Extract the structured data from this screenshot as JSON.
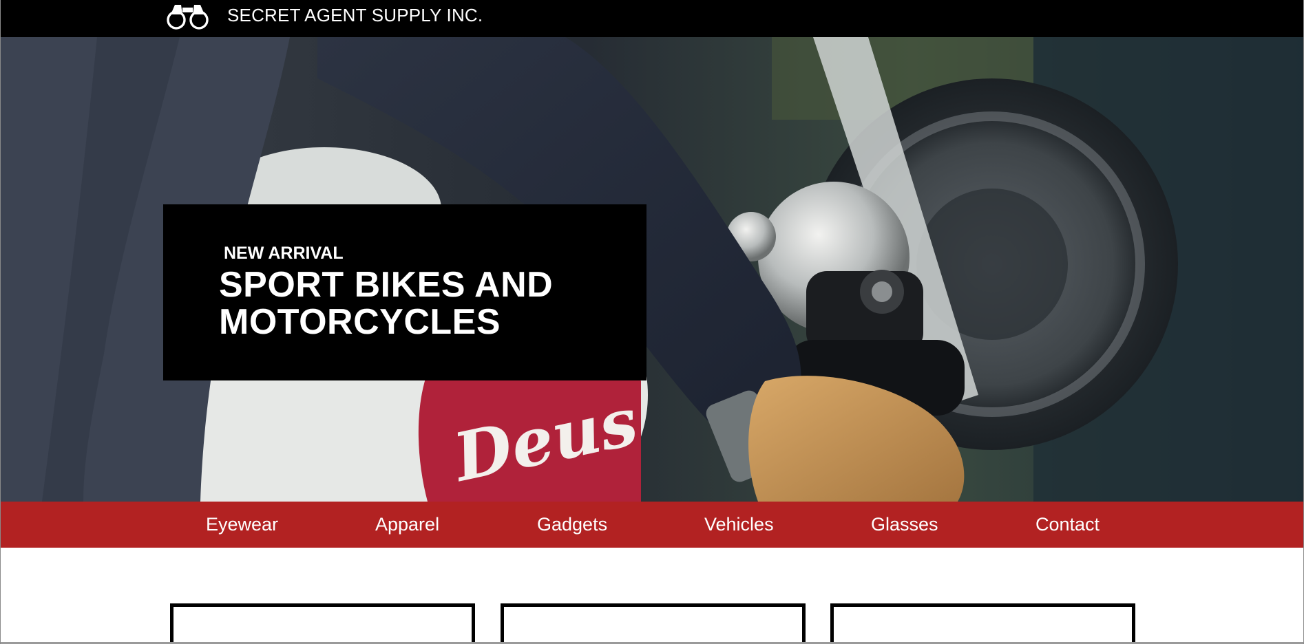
{
  "header": {
    "brand_name": "SECRET AGENT SUPPLY INC.",
    "brand_icon": "binoculars-icon"
  },
  "hero": {
    "eyebrow": "NEW ARRIVAL",
    "title": "SPORT BIKES AND MOTORCYCLES",
    "tank_lettering": "Deus"
  },
  "nav": {
    "items": [
      {
        "label": "Eyewear"
      },
      {
        "label": "Apparel"
      },
      {
        "label": "Gadgets"
      },
      {
        "label": "Vehicles"
      },
      {
        "label": "Glasses"
      },
      {
        "label": "Contact"
      }
    ]
  },
  "products": [
    {
      "name": ""
    },
    {
      "name": ""
    },
    {
      "name": ""
    }
  ],
  "colors": {
    "topbar": "#000000",
    "nav_background": "#b22222",
    "text_light": "#ffffff",
    "card_border": "#000000"
  }
}
